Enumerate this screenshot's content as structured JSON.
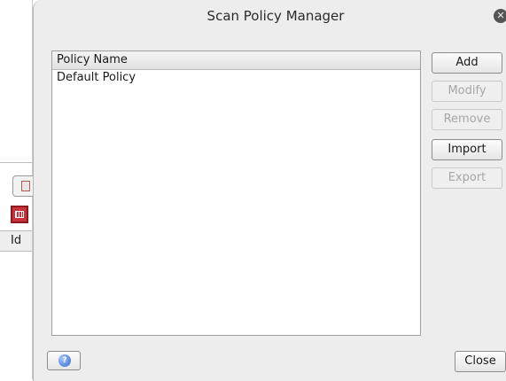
{
  "background": {
    "column_header": "Id"
  },
  "dialog": {
    "title": "Scan Policy Manager",
    "close_icon": "close-icon",
    "list": {
      "header": "Policy Name",
      "rows": [
        "Default Policy"
      ]
    },
    "buttons": {
      "add": "Add",
      "modify": "Modify",
      "remove": "Remove",
      "import": "Import",
      "export": "Export"
    },
    "help_icon": "help-icon",
    "close_button": "Close"
  }
}
